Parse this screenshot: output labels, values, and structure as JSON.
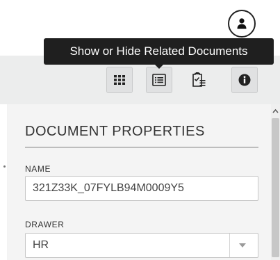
{
  "header": {
    "avatar_icon": "user-icon"
  },
  "toolbar": {
    "buttons": [
      {
        "icon": "grid-view-icon",
        "active": true
      },
      {
        "icon": "list-view-icon",
        "active": true
      },
      {
        "icon": "clipboard-list-icon",
        "active": false
      },
      {
        "icon": "info-icon",
        "active": true
      }
    ],
    "tooltip": "Show or Hide Related Documents"
  },
  "panel": {
    "title": "DOCUMENT PROPERTIES",
    "fields": [
      {
        "label": "NAME",
        "value": "321Z33K_07FYLB94M0009Y5"
      },
      {
        "label": "DRAWER",
        "value": "HR"
      }
    ]
  },
  "colors": {
    "toolbar_bg": "#eceded",
    "tooltip_bg": "#1f1f1f",
    "panel_bg": "#f4f4f4"
  }
}
